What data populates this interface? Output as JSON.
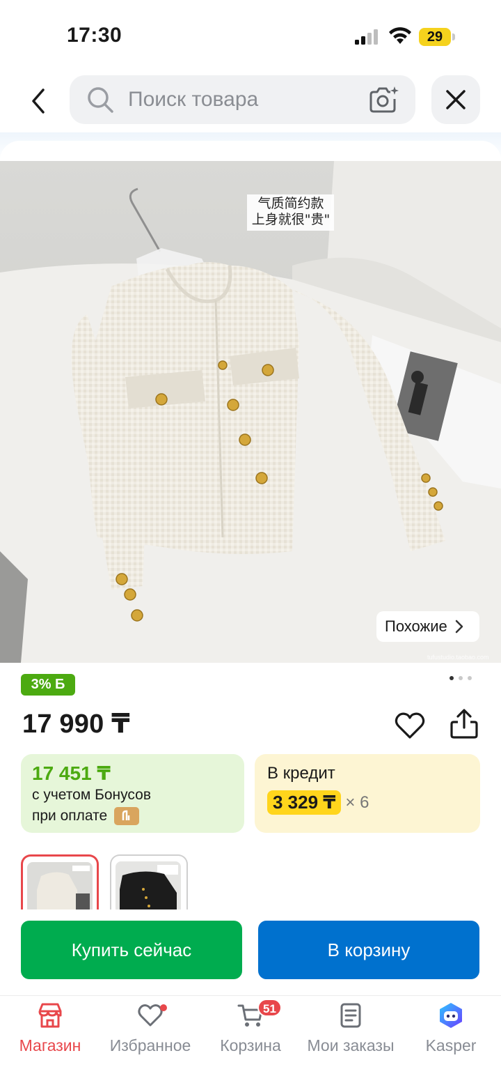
{
  "status_bar": {
    "time": "17:30",
    "battery": "29"
  },
  "search": {
    "placeholder": "Поиск товара"
  },
  "product": {
    "image_caption_line1": "气质简约款",
    "image_caption_line2": "上身就很\"贵\"",
    "watermark": "tufustudio.taobao.com",
    "similar_label": "Похожие",
    "bonus_badge": "3% Б",
    "price": "17 990 ₸"
  },
  "bonus_card": {
    "price": "17 451 ₸",
    "line1": "с учетом Бонусов",
    "line2": "при оплате"
  },
  "credit_card": {
    "title": "В кредит",
    "amount": "3 329 ₸",
    "multiplier": "× 6"
  },
  "actions": {
    "buy_label": "Купить сейчас",
    "cart_label": "В корзину"
  },
  "tabs": [
    {
      "label": "Магазин",
      "icon": "shop-icon",
      "active": true
    },
    {
      "label": "Избранное",
      "icon": "heart-icon"
    },
    {
      "label": "Корзина",
      "icon": "cart-icon",
      "badge": "51"
    },
    {
      "label": "Мои заказы",
      "icon": "orders-icon"
    },
    {
      "label": "Kasper",
      "icon": "kasper-icon"
    }
  ],
  "colors": {
    "accent_red": "#e8474b",
    "bonus_green": "#4caa11",
    "buy_green": "#00ac4f",
    "cart_blue": "#0071ce",
    "credit_yellow": "#ffd51c"
  }
}
